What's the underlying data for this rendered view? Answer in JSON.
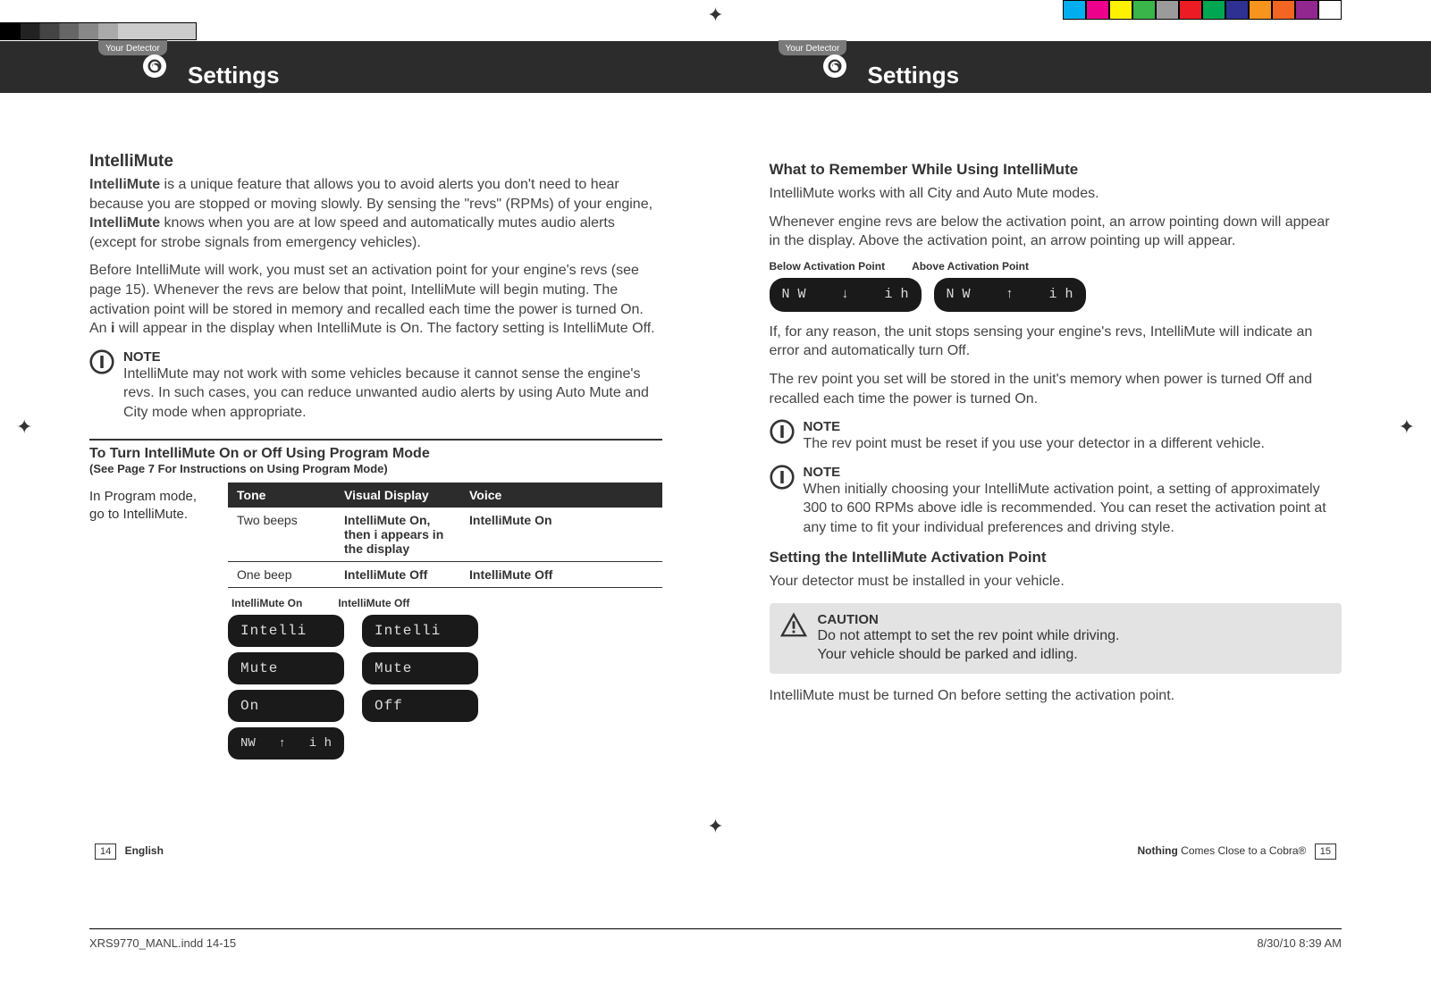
{
  "header": {
    "tab_label": "Your Detector",
    "title": "Settings"
  },
  "left": {
    "heading": "IntelliMute",
    "intro_parts": {
      "p1a": "IntelliMute",
      "p1b": " is a unique feature that allows you to avoid alerts you don't need to hear because you are stopped or moving slowly. By sensing the \"revs\" (RPMs) of your engine, ",
      "p1c": "IntelliMute",
      "p1d": " knows when you are at low speed and automatically mutes audio alerts (except for strobe signals from emergency vehicles)."
    },
    "para2_parts": {
      "a": "Before IntelliMute will work, you must set an activation point for your engine's revs (see page 15). Whenever the revs are below that point, IntelliMute will begin muting. The activation point will be stored in memory and recalled each time the power is turned On. An ",
      "b": "i",
      "c": " will appear in the display when IntelliMute is On. The factory setting is IntelliMute Off."
    },
    "note": {
      "label": "NOTE",
      "text": "IntelliMute may not work with some vehicles because it cannot sense the engine's revs. In such cases, you can reduce unwanted audio alerts by using Auto Mute and City mode when appropriate."
    },
    "table": {
      "title": "To Turn IntelliMute On or Off Using Program Mode",
      "subtitle": "(See Page 7 For Instructions on Using Program Mode)",
      "left_instruction": "In Program mode, go to IntelliMute.",
      "headers": {
        "c1": "Tone",
        "c2": "Visual Display",
        "c3": "Voice"
      },
      "rows": [
        {
          "c1": "Two beeps",
          "c2": "IntelliMute On, then i appears in the display",
          "c3": "IntelliMute On"
        },
        {
          "c1": "One beep",
          "c2": "IntelliMute Off",
          "c3": "IntelliMute Off"
        }
      ],
      "display_labels": {
        "on": "IntelliMute On",
        "off": "IntelliMute Off"
      },
      "pill_on": [
        "Intelli",
        "Mute",
        "On"
      ],
      "pill_off": [
        "Intelli",
        "Mute",
        "Off"
      ],
      "status_pill": {
        "left": "NW",
        "arrow": "↑",
        "right": "i   h"
      }
    },
    "footer": {
      "page": "14",
      "lang": "English"
    }
  },
  "right": {
    "heading1": "What to Remember While Using IntelliMute",
    "p1": "IntelliMute works with all City and Auto Mute modes.",
    "p2": "Whenever engine revs are below the activation point, an arrow pointing down will appear in the display. Above the activation point, an arrow pointing up will appear.",
    "act_labels": {
      "below": "Below Activation Point",
      "above": "Above Activation Point"
    },
    "act_pills": {
      "below": {
        "left": "N W",
        "arrow": "↓",
        "right": "i   h"
      },
      "above": {
        "left": "N W",
        "arrow": "↑",
        "right": "i   h"
      }
    },
    "p3": "If, for any reason, the unit stops sensing your engine's revs, IntelliMute will indicate an error and automatically turn Off.",
    "p4": "The rev point you set will be stored in the unit's memory when power is turned Off and recalled each time the power is turned On.",
    "note1": {
      "label": "NOTE",
      "text": "The rev point must be reset if you use your detector in a different vehicle."
    },
    "note2": {
      "label": "NOTE",
      "text": "When initially choosing your IntelliMute activation point, a setting of approximately 300 to 600 RPMs above idle is recommended. You can reset the activation point at any time to fit your individual preferences and driving style."
    },
    "heading2": "Setting the IntelliMute Activation Point",
    "p5": "Your detector must be installed in your vehicle.",
    "caution": {
      "label": "CAUTION",
      "line1": "Do not attempt to set the rev point while driving.",
      "line2": "Your vehicle should be parked and idling."
    },
    "p6": "IntelliMute must be turned On before setting the activation point.",
    "footer": {
      "tagline_bold": "Nothing",
      "tagline_rest": " Comes Close to a Cobra®",
      "page": "15"
    }
  },
  "imprint": {
    "file": "XRS9770_MANL.indd   14-15",
    "date": "8/30/10   8:39 AM"
  },
  "color_swatches": [
    "#00aeef",
    "#ec008c",
    "#fff200",
    "#39b54a",
    "#9b9b9b",
    "#ed1c24",
    "#00a651",
    "#2e3192",
    "#f7941d",
    "#f26522",
    "#92278f",
    "#ffffff"
  ]
}
